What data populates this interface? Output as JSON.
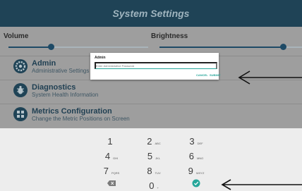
{
  "header": {
    "title": "System Settings"
  },
  "sliders": {
    "volume_label": "Volume",
    "brightness_label": "Brightness",
    "volume_level": 0.3,
    "brightness_level": 0.85
  },
  "menu": [
    {
      "title": "Admin",
      "subtitle": "Administrative Settings for A",
      "icon": "gear-icon"
    },
    {
      "title": "Diagnostics",
      "subtitle": "System Health Information",
      "icon": "bug-icon"
    },
    {
      "title": "Metrics Configuration",
      "subtitle": "Change the Metric Positions on Screen",
      "icon": "grid-icon"
    }
  ],
  "dialog": {
    "title": "Admin",
    "placeholder": "Enter Administrative Password",
    "cancel": "CANCEL",
    "submit": "SUBMIT"
  },
  "keypad": {
    "keys": [
      {
        "digit": "1",
        "letters": ""
      },
      {
        "digit": "2",
        "letters": "ABC"
      },
      {
        "digit": "3",
        "letters": "DEF"
      },
      {
        "digit": "4",
        "letters": "GHI"
      },
      {
        "digit": "5",
        "letters": "JKL"
      },
      {
        "digit": "6",
        "letters": "MNO"
      },
      {
        "digit": "7",
        "letters": "PQRS"
      },
      {
        "digit": "8",
        "letters": "TUV"
      },
      {
        "digit": "9",
        "letters": "WXYZ"
      }
    ],
    "zero": "0",
    "zero_letters": "+"
  },
  "colors": {
    "accent": "#26a69a",
    "header": "#1f4356",
    "slider": "#1e4a66"
  }
}
